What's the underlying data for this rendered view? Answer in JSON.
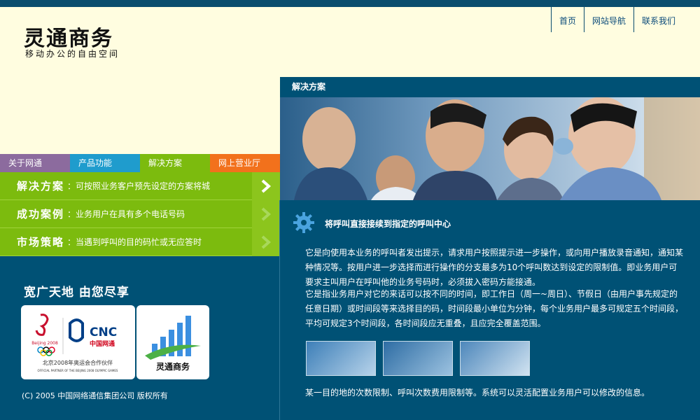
{
  "brand": {
    "title": "灵通商务",
    "subtitle": "移动办公的自由空间"
  },
  "topnav": [
    "首页",
    "网站导航",
    "联系我们"
  ],
  "tabs": [
    {
      "label": "关于网通",
      "color": "#8c6b9e"
    },
    {
      "label": "产品功能",
      "color": "#1f9ccd"
    },
    {
      "label": "解决方案",
      "color": "#7cbb0e"
    },
    {
      "label": "网上营业厅",
      "color": "#f2711c"
    }
  ],
  "menu": [
    {
      "title": "解决方案",
      "desc": "：可按照业务客户预先设定的方案将城"
    },
    {
      "title": "成功案例",
      "desc": "：业务用户在具有多个电话号码"
    },
    {
      "title": "市场策略",
      "desc": "：当遇到呼叫的目的码忙或无应答时"
    }
  ],
  "slogan": "宽广天地 由您尽享",
  "partner": {
    "cnc": "CNC",
    "cnc_cn": "中国网通",
    "beijing": "Beijing 2008",
    "line1": "北京2008年奥运会合作伙伴",
    "line2": "OFFICIAL PARTNER OF THE BEIJING 2008 OLYMPIC GAMES"
  },
  "card2_label": "灵通商务",
  "copyright": "(C) 2005 中国网络通信集团公司 版权所有",
  "section": {
    "bar_title": "解决方案",
    "content_title": "将呼叫直接接续到指定的呼叫中心",
    "para1": "它是向使用本业务的呼叫者发出提示，请求用户按照提示进一步操作，或向用户播放录音通知，通知某种情况等。按用户进一步选择而进行操作的分支最多为10个呼叫数达到设定的限制值。即业务用户可要求主叫用户在呼叫他的业务号码时，必须拔入密码方能接通。",
    "para2": "它是指业务用户对它的来话可以按不同的时间，即工作日（周一~周日）、节假日（由用户事先规定的任意日期）或时间段等来选择目的码，时间段最小单位为分钟，每个业务用户最多可规定五个时间段，平均可规定3个时间段，各时间段应无重叠，且应完全覆盖范围。",
    "footer": "某一目的地的次数限制、呼叫次数费用限制等。系统可以灵活配置业务用户可以修改的信息。"
  },
  "icons": {
    "gear": "gear-icon",
    "arrow": "chevron-right-icon"
  }
}
